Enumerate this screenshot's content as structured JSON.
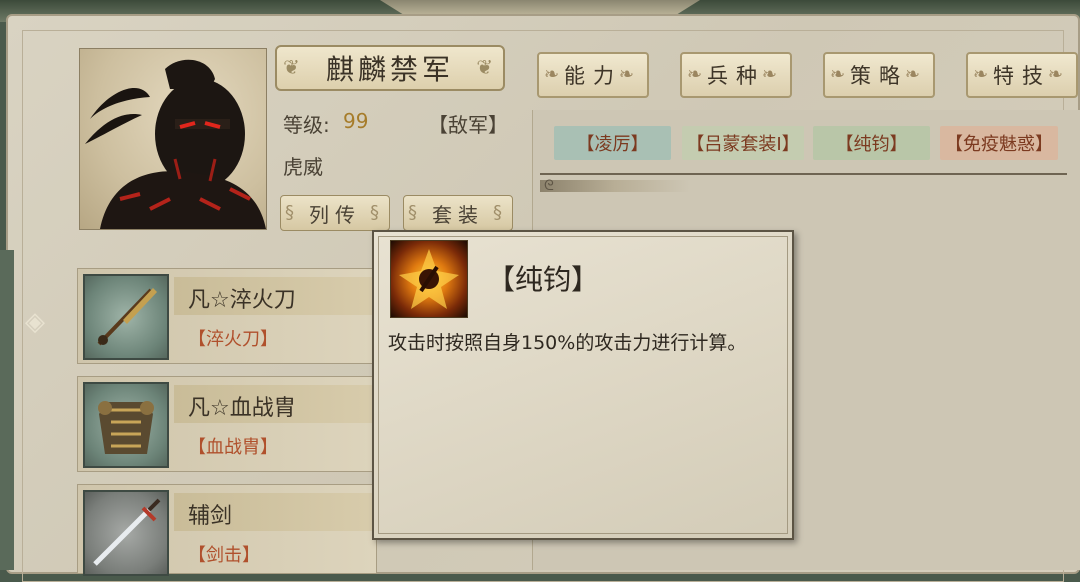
{
  "general": {
    "name": "麒麟禁军",
    "level_label": "等级:",
    "level_value": "99",
    "faction": "【敌军】",
    "subtitle": "虎威"
  },
  "buttons": {
    "biography": "列传",
    "set": "套装"
  },
  "tabs": [
    {
      "label": "能力"
    },
    {
      "label": "兵种"
    },
    {
      "label": "策略"
    },
    {
      "label": "特技"
    }
  ],
  "tags": [
    {
      "label": "【凌厉】",
      "color": "#a9c0b4"
    },
    {
      "label": "【吕蒙套装Ⅰ】",
      "color": "#c4ccb0"
    },
    {
      "label": "【纯钧】",
      "color": "#b9c6a8"
    },
    {
      "label": "【免疫魅惑】",
      "color": "#d9b8a0"
    }
  ],
  "equipment": [
    {
      "name": "凡☆淬火刀",
      "type": "【淬火刀】",
      "icon": "blade-icon"
    },
    {
      "name": "凡☆血战胄",
      "type": "【血战胄】",
      "icon": "armor-icon"
    },
    {
      "name": "辅剑",
      "type": "【剑击】",
      "icon": "sword-icon"
    }
  ],
  "tooltip": {
    "title": "【纯钧】",
    "description": "攻击时按照自身150%的攻击力进行计算。"
  }
}
